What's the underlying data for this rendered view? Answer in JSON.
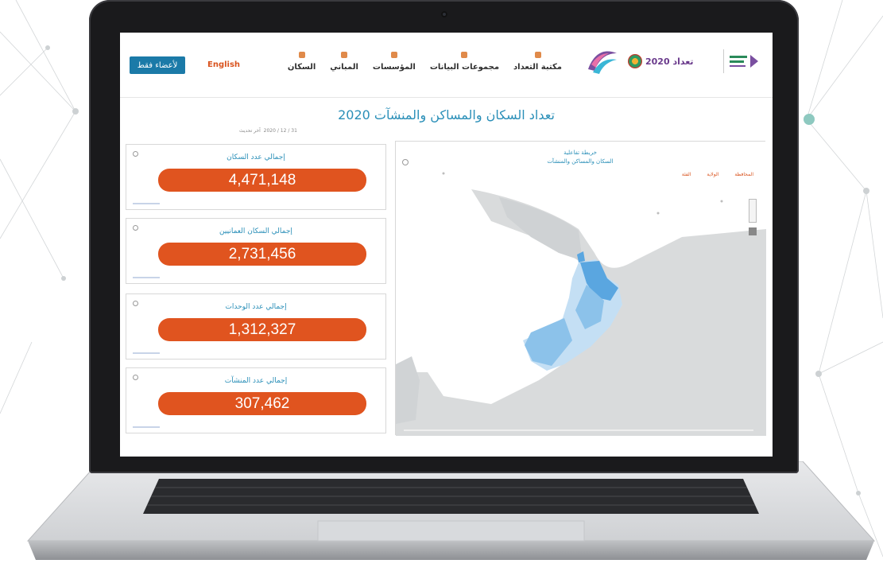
{
  "header": {
    "login_label": "لأعضاء فقط",
    "language_label": "English",
    "nav_items": [
      {
        "label": "السكان"
      },
      {
        "label": "المباني"
      },
      {
        "label": "المؤسسات"
      },
      {
        "label": "مجموعات البيانات"
      },
      {
        "label": "مكتبة التعداد"
      }
    ],
    "census_logo_text": "تعداد 2020"
  },
  "page": {
    "title": "تعداد السكان والمساكن والمنشآت 2020",
    "subtitle": "آخر تحديث ‎ 2020 / 12 / 31"
  },
  "stats": [
    {
      "label": "إجمالي عدد السكان",
      "value": "4,471,148"
    },
    {
      "label": "إجمالي السكان العمانيين",
      "value": "2,731,456"
    },
    {
      "label": "إجمالي عدد الوحدات",
      "value": "1,312,327"
    },
    {
      "label": "إجمالي عدد المنشآت",
      "value": "307,462"
    }
  ],
  "map": {
    "title": "خريطة تفاعلية",
    "subtitle": "السكان والمساكن والمنشآت",
    "legend": [
      "المحافظة",
      "الولاية",
      "الفئة"
    ],
    "colors": {
      "land": "#d9dbdc",
      "sea": "#ffffff",
      "oman_dark": "#5aa6e0",
      "oman_mid": "#8cc2ea",
      "oman_light": "#c4dff4"
    }
  },
  "colors": {
    "accent": "#e0541f",
    "primary": "#2a8fb8",
    "button": "#1b7aa8"
  }
}
